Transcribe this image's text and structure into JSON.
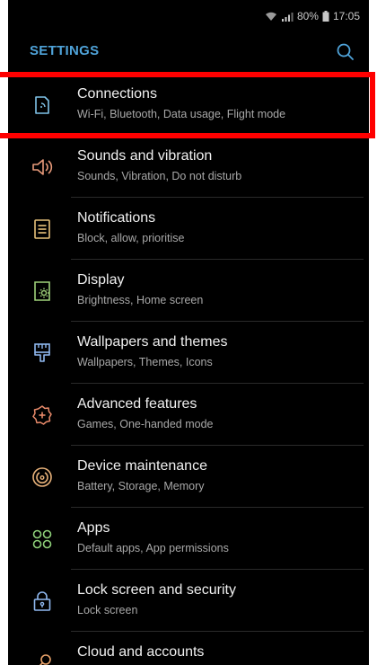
{
  "status": {
    "battery": "80%",
    "time": "17:05"
  },
  "header": {
    "title": "SETTINGS"
  },
  "items": [
    {
      "label": "Connections",
      "sub": "Wi-Fi, Bluetooth, Data usage, Flight mode",
      "icon": "connections-icon",
      "color": "#7fc3e8"
    },
    {
      "label": "Sounds and vibration",
      "sub": "Sounds, Vibration, Do not disturb",
      "icon": "speaker-icon",
      "color": "#e89a7a"
    },
    {
      "label": "Notifications",
      "sub": "Block, allow, prioritise",
      "icon": "notifications-icon",
      "color": "#e8c27a"
    },
    {
      "label": "Display",
      "sub": "Brightness, Home screen",
      "icon": "display-icon",
      "color": "#9fd27a"
    },
    {
      "label": "Wallpapers and themes",
      "sub": "Wallpapers, Themes, Icons",
      "icon": "brush-icon",
      "color": "#8fb8ef"
    },
    {
      "label": "Advanced features",
      "sub": "Games, One-handed mode",
      "icon": "advanced-gear-icon",
      "color": "#e88a6a"
    },
    {
      "label": "Device maintenance",
      "sub": "Battery, Storage, Memory",
      "icon": "maintenance-icon",
      "color": "#e8b27a"
    },
    {
      "label": "Apps",
      "sub": "Default apps, App permissions",
      "icon": "apps-icon",
      "color": "#8fd27a"
    },
    {
      "label": "Lock screen and security",
      "sub": "Lock screen",
      "icon": "lock-icon",
      "color": "#8fb8ef"
    },
    {
      "label": "Cloud and accounts",
      "sub": "",
      "icon": "key-icon",
      "color": "#e8a26a"
    }
  ],
  "colors": {
    "accent": "#4fa3d9",
    "highlight": "#ff0000"
  }
}
